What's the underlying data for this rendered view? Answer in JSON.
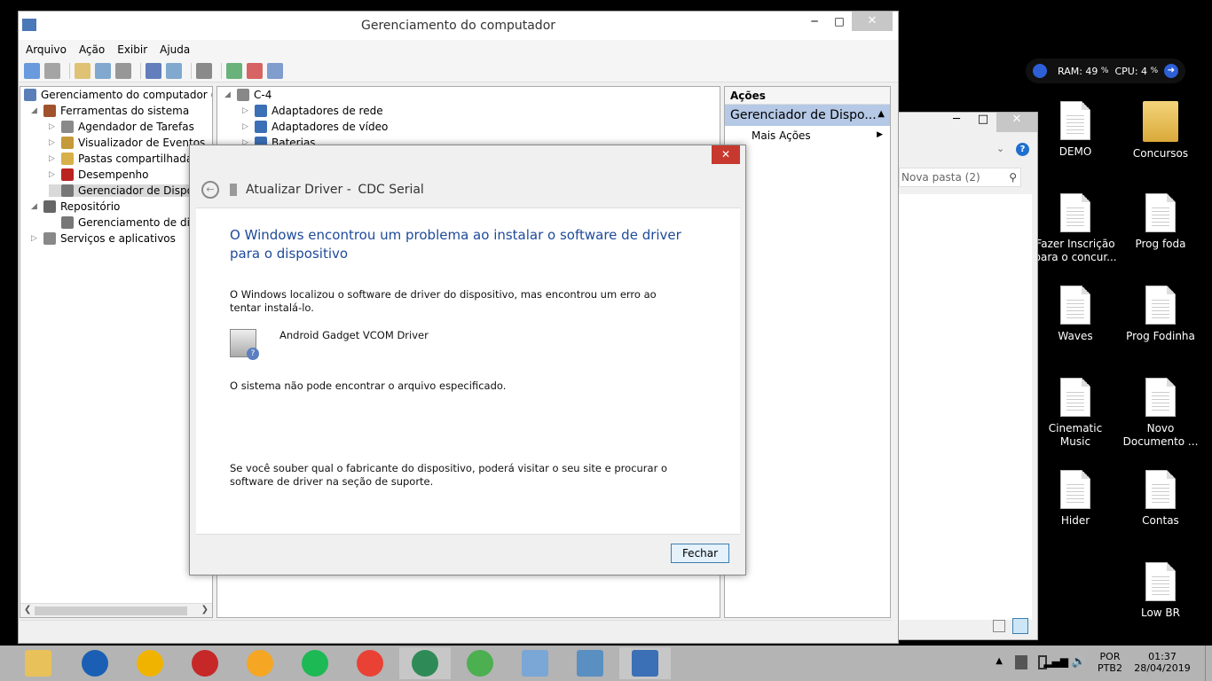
{
  "window": {
    "title": "Gerenciamento do computador",
    "min_label": "─",
    "max_label": "□",
    "close_label": "✕"
  },
  "menu": [
    "Arquivo",
    "Ação",
    "Exibir",
    "Ajuda"
  ],
  "toolbar_icons": [
    "back-arrow-icon",
    "forward-arrow-icon",
    "up-folder-icon",
    "show-hide-tree-icon",
    "properties-icon",
    "help-icon",
    "help-topic-icon",
    "scan-hardware-icon",
    "update-driver-icon",
    "uninstall-icon",
    "disable-device-icon"
  ],
  "tree": {
    "root": "Gerenciamento do computador (loc",
    "items": [
      {
        "label": "Ferramentas do sistema",
        "level": 1,
        "expanded": true
      },
      {
        "label": "Agendador de Tarefas",
        "level": 2,
        "expanded": false
      },
      {
        "label": "Visualizador de Eventos",
        "level": 2,
        "expanded": false
      },
      {
        "label": "Pastas compartilhadas",
        "level": 2,
        "expanded": false
      },
      {
        "label": "Desempenho",
        "level": 2,
        "expanded": false
      },
      {
        "label": "Gerenciador de Dispositi",
        "level": 2,
        "selected": true
      },
      {
        "label": "Repositório",
        "level": 1,
        "expanded": true
      },
      {
        "label": "Gerenciamento de disco",
        "level": 2
      },
      {
        "label": "Serviços e aplicativos",
        "level": 1,
        "expanded": false
      }
    ]
  },
  "devices": {
    "root": "C-4",
    "items": [
      "Adaptadores de rede",
      "Adaptadores de vídeo",
      "Baterias"
    ]
  },
  "actions": {
    "header": "Ações",
    "selected": "Gerenciador de Dispo...",
    "more": "Mais Ações"
  },
  "dialog": {
    "title_prefix": "Atualizar Driver -",
    "title_device": "CDC Serial",
    "heading": "O Windows encontrou um problema ao instalar o software de driver para o dispositivo",
    "p1": "O Windows localizou o software de driver do dispositivo, mas encontrou um erro ao tentar instalá-lo.",
    "driver_name": "Android Gadget VCOM Driver",
    "p2": "O sistema não pode encontrar o arquivo especificado.",
    "p3": "Se você souber qual o fabricante do dispositivo, poderá visitar o seu site e procurar o software de driver na seção de suporte.",
    "close_button": "Fechar",
    "close_x": "✕"
  },
  "explorer": {
    "search_placeholder": "Nova pasta (2)"
  },
  "widget": {
    "ram": "RAM: 49",
    "ram_unit": "%",
    "cpu": "CPU: 4",
    "cpu_unit": "%"
  },
  "desktop_icons": [
    {
      "label": "DEMO",
      "type": "doc"
    },
    {
      "label": "Concursos",
      "type": "folder"
    },
    {
      "label": "Fazer Inscrição para o concur...",
      "type": "doc"
    },
    {
      "label": "Prog foda",
      "type": "doc"
    },
    {
      "label": "Waves",
      "type": "doc"
    },
    {
      "label": "Prog Fodinha",
      "type": "doc"
    },
    {
      "label": "Cinematic Music",
      "type": "doc"
    },
    {
      "label": "Novo Documento ...",
      "type": "doc"
    },
    {
      "label": "Hider",
      "type": "doc"
    },
    {
      "label": "Contas",
      "type": "doc"
    },
    {
      "label": "Low BR",
      "type": "doc"
    }
  ],
  "taskbar": {
    "apps": [
      {
        "name": "file-explorer-icon",
        "color": "#e8c15a"
      },
      {
        "name": "ccleaner-icon",
        "color": "#1a5fb4"
      },
      {
        "name": "aimp-icon",
        "color": "#f0b400"
      },
      {
        "name": "game-app-icon",
        "color": "#c62828"
      },
      {
        "name": "fl-studio-icon",
        "color": "#f5a623"
      },
      {
        "name": "spotify-icon",
        "color": "#1db954"
      },
      {
        "name": "chrome-icon",
        "color": "#e94235"
      },
      {
        "name": "idm-icon",
        "color": "#2e8b57"
      },
      {
        "name": "utorrent-icon",
        "color": "#4caf50"
      },
      {
        "name": "resource-monitor-icon",
        "color": "#7aa7d6"
      },
      {
        "name": "photos-icon",
        "color": "#5a8fc2"
      },
      {
        "name": "computer-management-icon",
        "color": "#3b6fb6"
      }
    ],
    "lang1": "POR",
    "lang2": "PTB2",
    "time": "01:37",
    "date": "28/04/2019"
  }
}
